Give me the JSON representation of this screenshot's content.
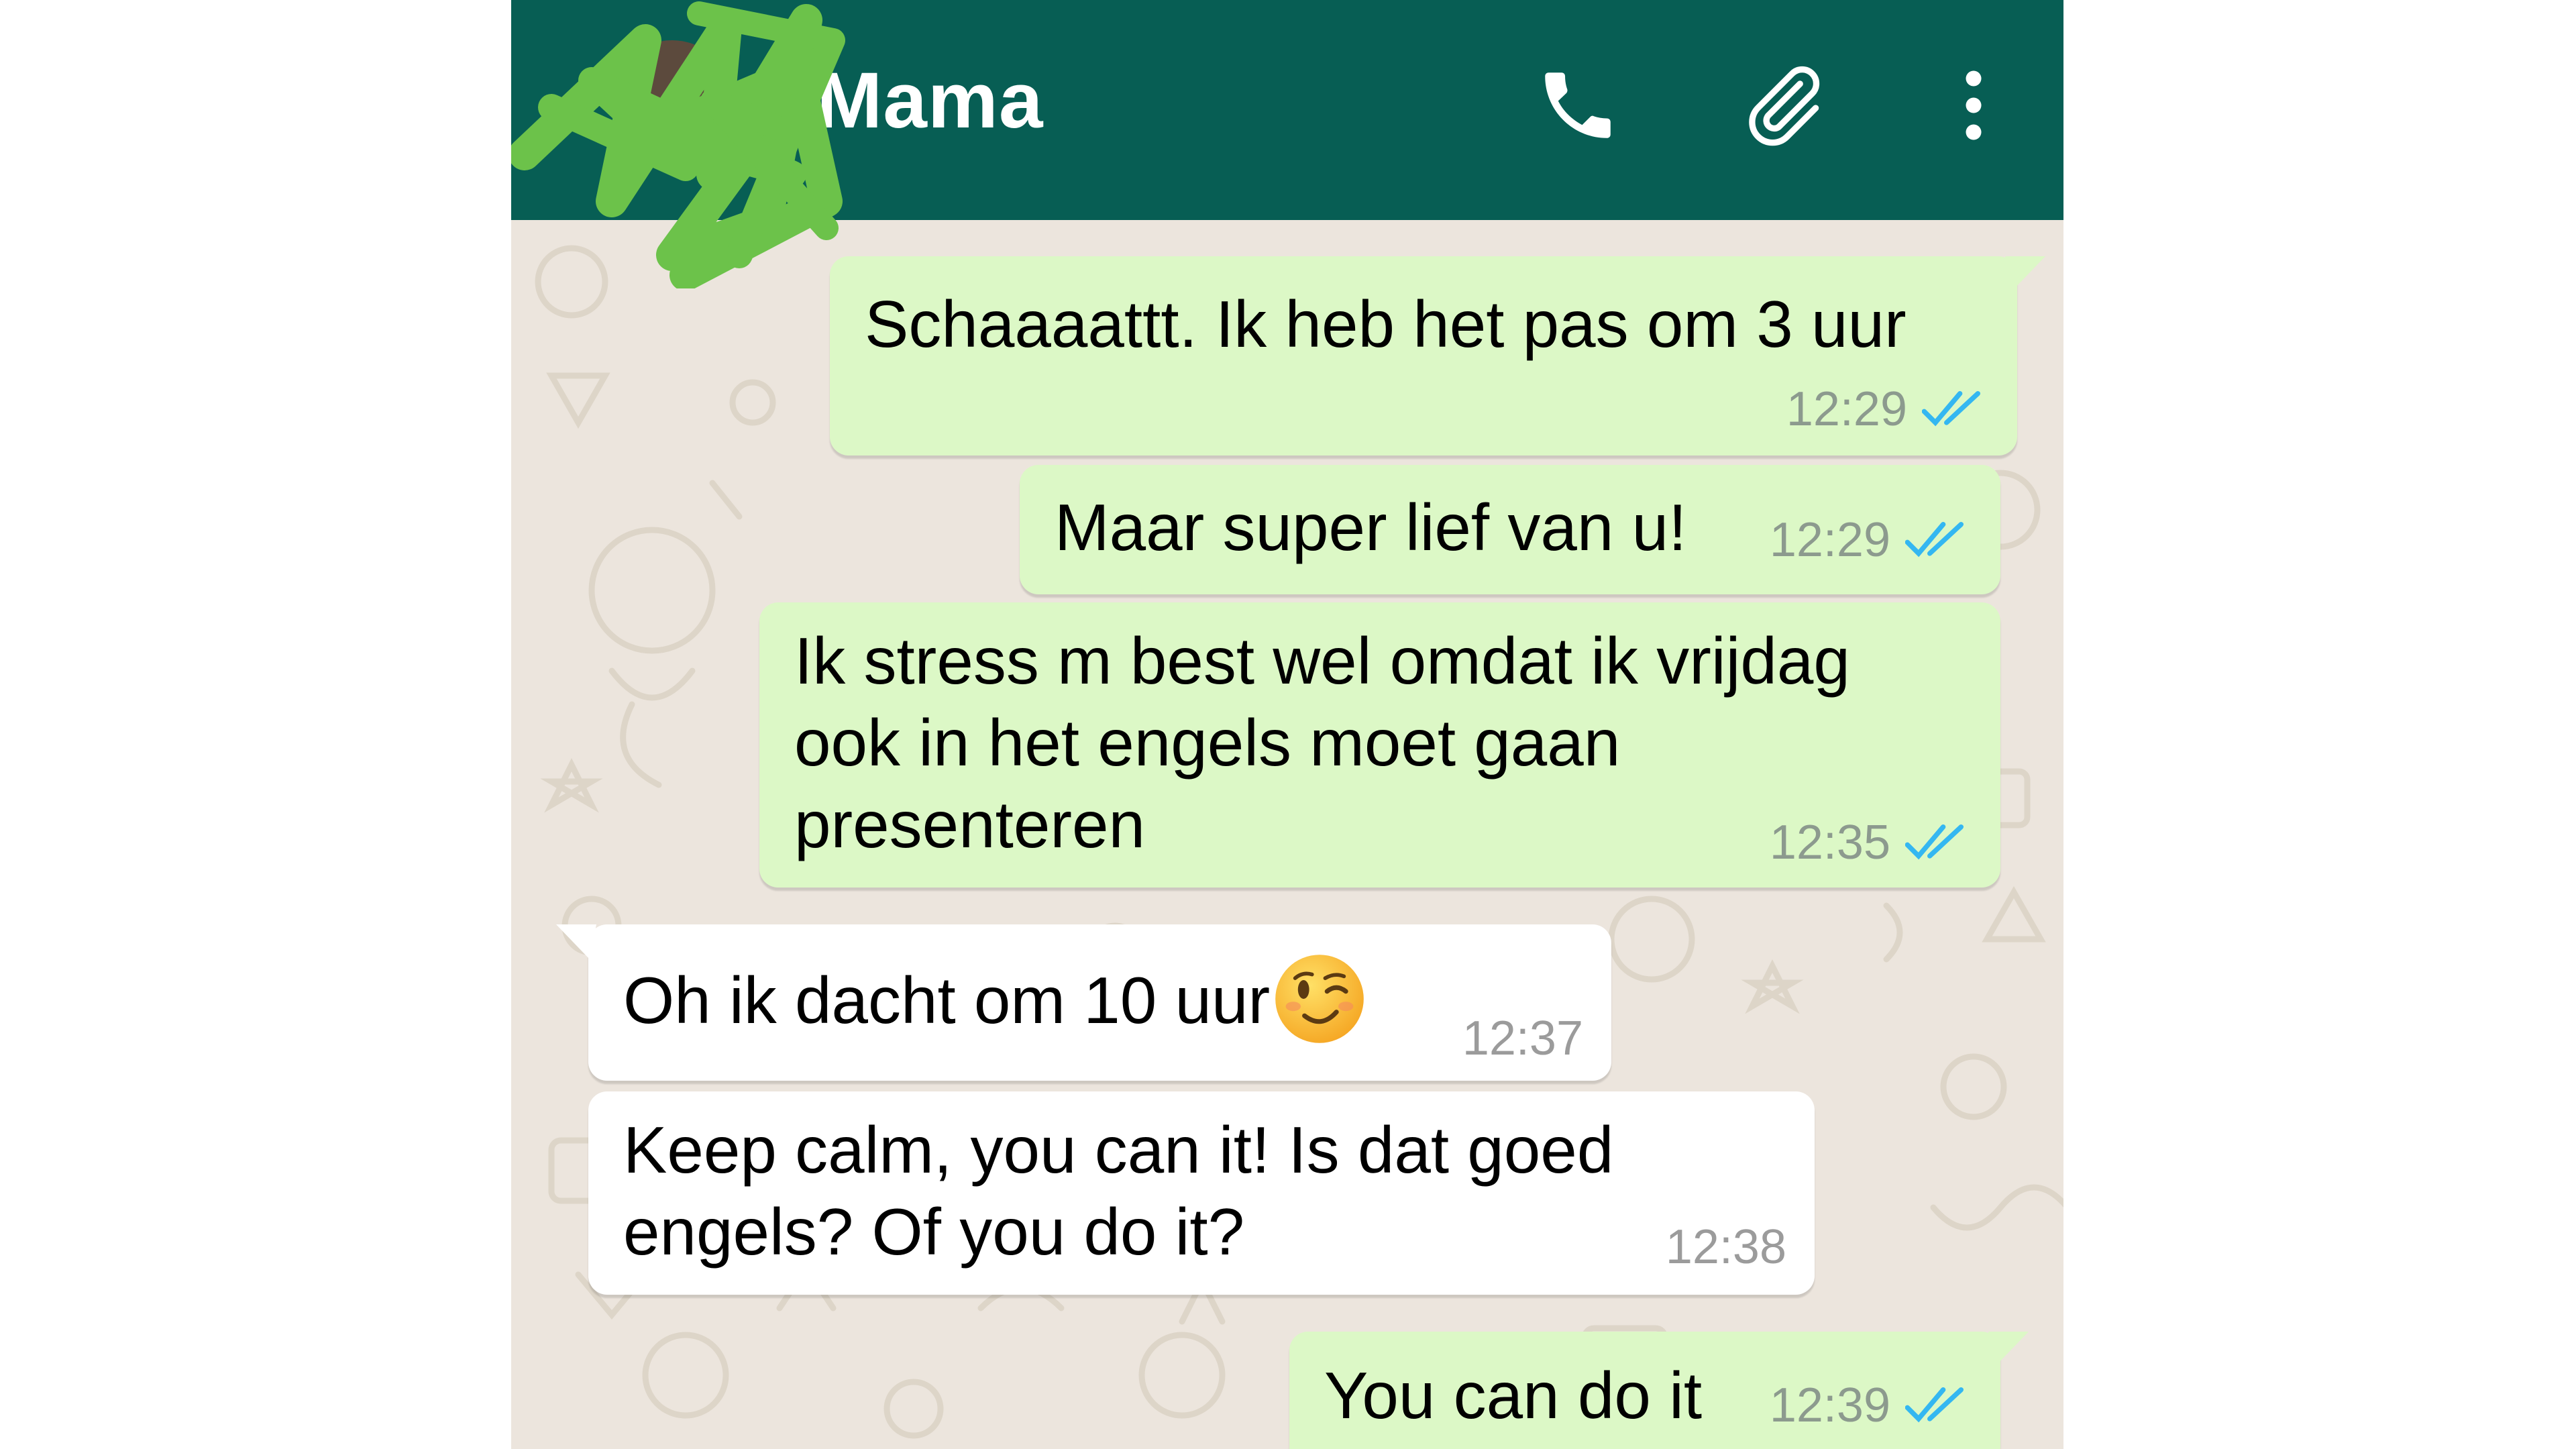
{
  "header": {
    "contact_name": "Mama",
    "icons": [
      "back-arrow-icon",
      "call-icon",
      "attachment-clip-icon",
      "more-vertical-icon"
    ]
  },
  "colors": {
    "header": "#075e54",
    "outgoing_bubble": "#dcf8c6",
    "incoming_bubble": "#ffffff",
    "background": "#ece5dd",
    "read_ticks": "#34b7f1",
    "redaction_scribble": "#6cc24a"
  },
  "messages": [
    {
      "direction": "outgoing",
      "lines": [
        "Schaaaattt. Ik heb het pas om 3 uur"
      ],
      "time": "12:29",
      "status": "read"
    },
    {
      "direction": "outgoing",
      "lines": [
        "Maar super lief van u!"
      ],
      "time": "12:29",
      "status": "read"
    },
    {
      "direction": "outgoing",
      "lines": [
        "Ik stress m best wel omdat ik vrijdag",
        "ook in het engels moet gaan",
        "presenteren"
      ],
      "time": "12:35",
      "status": "read"
    },
    {
      "direction": "incoming",
      "lines": [
        "Oh ik dacht om 10 uur"
      ],
      "emoji": "winking-face",
      "time": "12:37"
    },
    {
      "direction": "incoming",
      "lines": [
        "Keep calm, you can it! Is dat goed",
        "engels? Of you do it?"
      ],
      "time": "12:38"
    },
    {
      "direction": "outgoing",
      "lines": [
        "You can do it"
      ],
      "time": "12:39",
      "status": "read"
    }
  ]
}
